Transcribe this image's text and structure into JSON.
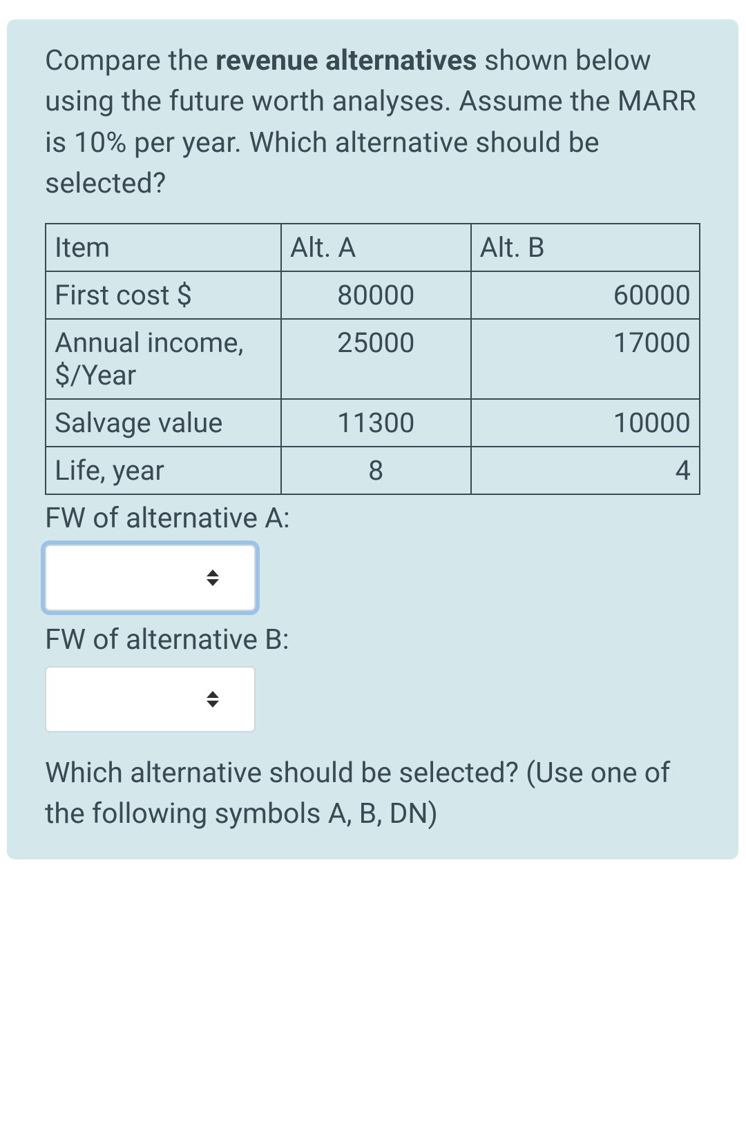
{
  "intro": {
    "pre": "Compare the ",
    "bold": "revenue alternatives",
    "post": " shown below using the future worth analyses. Assume the MARR is 10% per year. Which alternative should be selected?"
  },
  "table": {
    "header": {
      "item": "Item",
      "a": "Alt. A",
      "b": "Alt. B"
    },
    "rows": [
      {
        "label": "First cost $",
        "a": "80000",
        "b": "60000"
      },
      {
        "label": "Annual income, $/Year",
        "a": "25000",
        "b": "17000"
      },
      {
        "label": "Salvage value",
        "a": "11300",
        "b": "10000"
      },
      {
        "label": "Life, year",
        "a": "8",
        "b": "4"
      }
    ]
  },
  "labels": {
    "fw_a": "FW of alternative A:",
    "fw_b": "FW of alternative B:"
  },
  "inputs": {
    "fw_a_value": "",
    "fw_b_value": ""
  },
  "question": "Which alternative should be selected? (Use one of the following symbols A, B, DN)"
}
